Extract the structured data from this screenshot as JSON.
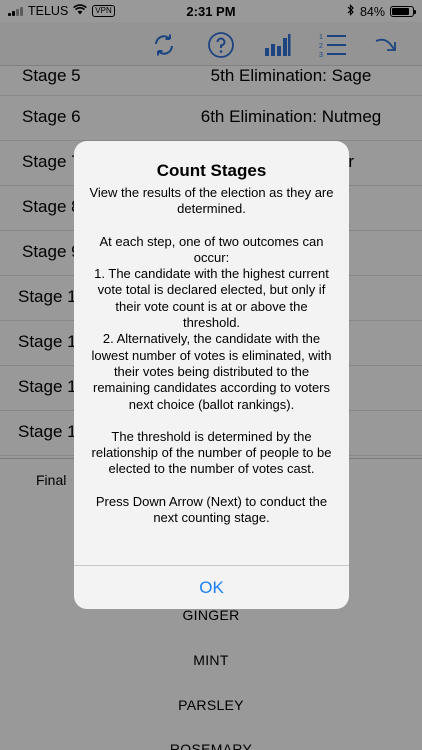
{
  "status_bar": {
    "carrier": "TELUS",
    "vpn": "VPN",
    "time": "2:31 PM",
    "battery": "84%",
    "battery_level": 0.84
  },
  "toolbar": {
    "icons": [
      "refresh-icon",
      "help-icon",
      "bar-chart-icon",
      "numbered-list-icon",
      "forward-icon"
    ],
    "accent_color": "#2f72d6"
  },
  "stages": [
    {
      "label": "Stage 5",
      "description": "5th Elimination: Sage"
    },
    {
      "label": "Stage 6",
      "description": "6th Elimination: Nutmeg"
    },
    {
      "label": "Stage 7",
      "description": "r"
    },
    {
      "label": "Stage 8",
      "description": ""
    },
    {
      "label": "Stage 9",
      "description": ""
    },
    {
      "label": "Stage 1",
      "description": ""
    },
    {
      "label": "Stage 1",
      "description": ""
    },
    {
      "label": "Stage 1",
      "description": ""
    },
    {
      "label": "Stage 1",
      "description": ""
    }
  ],
  "final": {
    "label": "Final",
    "elected": [
      "GINGER",
      "MINT",
      "PARSLEY",
      "ROSEMARY"
    ]
  },
  "dialog": {
    "title": "Count Stages",
    "paragraphs": [
      "View the results of the election as they are determined.",
      "At each step, one of two outcomes can occur:\n1. The candidate with the highest current vote total is declared elected, but only if their vote count is at or above the threshold.\n2. Alternatively, the candidate with the lowest number of votes is eliminated, with their votes being distributed to the remaining candidates according to voters next choice (ballot rankings).",
      "The threshold is determined by the relationship of the number of people to be elected to the number of votes cast.",
      "Press Down Arrow (Next) to conduct the next counting stage."
    ],
    "ok_label": "OK"
  }
}
